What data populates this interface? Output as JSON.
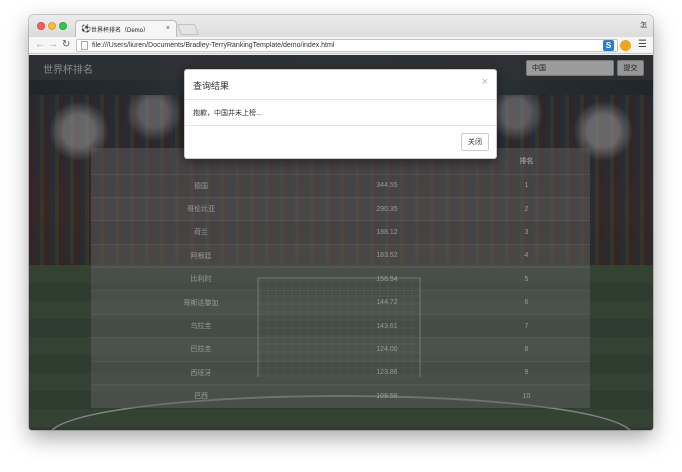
{
  "browser": {
    "tab_icon": "⚽",
    "tab_title": "世界杯排名（Demo）",
    "tab_close": "×",
    "profile": "怎",
    "url": "file:///Users/liuren/Documents/Bradley-TerryRankingTemplate/demo/index.html",
    "ext_letter": "S",
    "icons": {
      "back": "back-arrow-icon",
      "forward": "forward-arrow-icon",
      "reload": "reload-icon",
      "star": "star-icon",
      "menu": "hamburger-menu-icon"
    }
  },
  "navbar": {
    "brand": "世界杯排名",
    "search_value": "中国",
    "submit_label": "提交"
  },
  "table": {
    "headers": [
      "",
      "",
      "排名"
    ],
    "rows": [
      {
        "team": "德国",
        "score": "344.55",
        "rank": "1"
      },
      {
        "team": "哥伦比亚",
        "score": "290.35",
        "rank": "2"
      },
      {
        "team": "荷兰",
        "score": "188.12",
        "rank": "3"
      },
      {
        "team": "阿根廷",
        "score": "183.52",
        "rank": "4"
      },
      {
        "team": "比利时",
        "score": "156.94",
        "rank": "5"
      },
      {
        "team": "哥斯达黎加",
        "score": "144.72",
        "rank": "6"
      },
      {
        "team": "乌拉圭",
        "score": "143.61",
        "rank": "7"
      },
      {
        "team": "巴拉圭",
        "score": "124.00",
        "rank": "8"
      },
      {
        "team": "西班牙",
        "score": "123.86",
        "rank": "9"
      },
      {
        "team": "巴西",
        "score": "108.58",
        "rank": "10"
      }
    ]
  },
  "modal": {
    "title": "查询结果",
    "close_x": "×",
    "message": "抱歉，中国并未上榜...",
    "close_label": "关闭"
  }
}
